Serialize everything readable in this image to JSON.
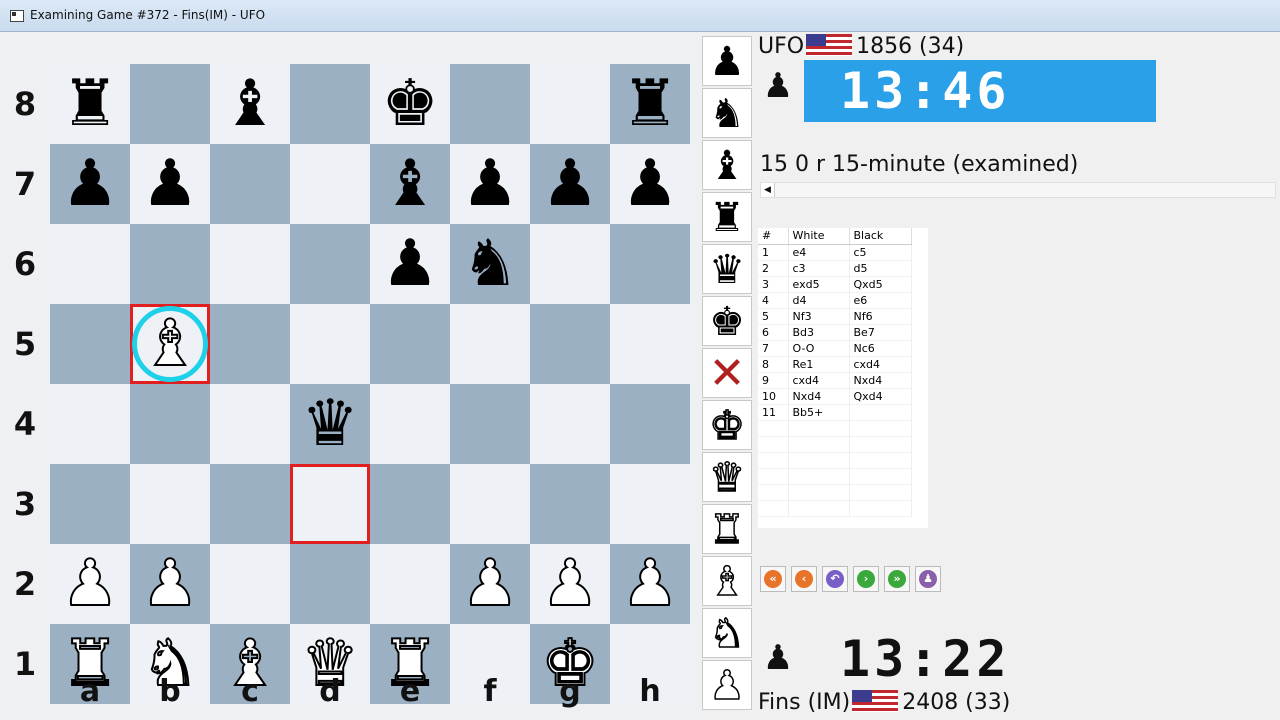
{
  "window": {
    "title": "Examining Game #372 - Fins(IM) - UFO"
  },
  "board": {
    "ranks": [
      "8",
      "7",
      "6",
      "5",
      "4",
      "3",
      "2",
      "1"
    ],
    "files": [
      "a",
      "b",
      "c",
      "d",
      "e",
      "f",
      "g",
      "h"
    ],
    "position": [
      [
        "br",
        "",
        "bb",
        "",
        "bk",
        "",
        "",
        "br"
      ],
      [
        "bp",
        "bp",
        "",
        "",
        "bb",
        "bp",
        "bp",
        "bp"
      ],
      [
        "",
        "",
        "",
        "",
        "bp",
        "bn",
        "",
        ""
      ],
      [
        "",
        "wb",
        "",
        "",
        "",
        "",
        "",
        ""
      ],
      [
        "",
        "",
        "",
        "bq",
        "",
        "",
        "",
        ""
      ],
      [
        "",
        "",
        "",
        "",
        "",
        "",
        "",
        ""
      ],
      [
        "wp",
        "wp",
        "",
        "",
        "",
        "wp",
        "wp",
        "wp"
      ],
      [
        "wr",
        "wn",
        "wb",
        "wq",
        "wr",
        "",
        "wk",
        ""
      ]
    ],
    "last_move_from": "d3",
    "last_move_to": "b5"
  },
  "palette": {
    "items": [
      "bp",
      "bn",
      "bb",
      "br",
      "bq",
      "bk",
      "delete",
      "wk",
      "wq",
      "wr",
      "wb",
      "wn",
      "wp"
    ],
    "names": {
      "bp": "black-pawn-icon",
      "bn": "black-knight-icon",
      "bb": "black-bishop-icon",
      "br": "black-rook-icon",
      "bq": "black-queen-icon",
      "bk": "black-king-icon",
      "delete": "delete-x-icon",
      "wk": "white-king-icon",
      "wq": "white-queen-icon",
      "wr": "white-rook-icon",
      "wb": "white-bishop-icon",
      "wn": "white-knight-icon",
      "wp": "white-pawn-icon"
    }
  },
  "top_player": {
    "name": "UFO",
    "rating": "1856 (34)",
    "clock": "13:46",
    "flag": "us-flag-icon"
  },
  "bottom_player": {
    "name": "Fins (IM)",
    "rating": "2408 (33)",
    "clock": "13:22",
    "flag": "us-flag-icon"
  },
  "game_info": "15 0 r 15-minute (examined)",
  "movelist": {
    "headers": [
      "#",
      "White",
      "Black"
    ],
    "moves": [
      [
        "1",
        "e4",
        "c5"
      ],
      [
        "2",
        "c3",
        "d5"
      ],
      [
        "3",
        "exd5",
        "Qxd5"
      ],
      [
        "4",
        "d4",
        "e6"
      ],
      [
        "5",
        "Nf3",
        "Nf6"
      ],
      [
        "6",
        "Bd3",
        "Be7"
      ],
      [
        "7",
        "O-O",
        "Nc6"
      ],
      [
        "8",
        "Re1",
        "cxd4"
      ],
      [
        "9",
        "cxd4",
        "Nxd4"
      ],
      [
        "10",
        "Nxd4",
        "Qxd4"
      ],
      [
        "11",
        "Bb5+",
        ""
      ]
    ]
  },
  "nav_buttons": [
    {
      "name": "first-move-button",
      "glyph": "«",
      "color": "#e8742a"
    },
    {
      "name": "prev-move-button",
      "glyph": "‹",
      "color": "#e8742a"
    },
    {
      "name": "undo-button",
      "glyph": "↶",
      "color": "#7a5ec8"
    },
    {
      "name": "next-move-button",
      "glyph": "›",
      "color": "#3aa83a"
    },
    {
      "name": "last-move-button",
      "glyph": "»",
      "color": "#3aa83a"
    },
    {
      "name": "analysis-button",
      "glyph": "♟",
      "color": "#8a5ea8"
    }
  ],
  "colors": {
    "light_square": "#eef2f7",
    "dark_square": "#9cb0c4",
    "clock_active": "#2aa0e8",
    "highlight": "#e02020",
    "check_ring": "#1ed0e8"
  }
}
